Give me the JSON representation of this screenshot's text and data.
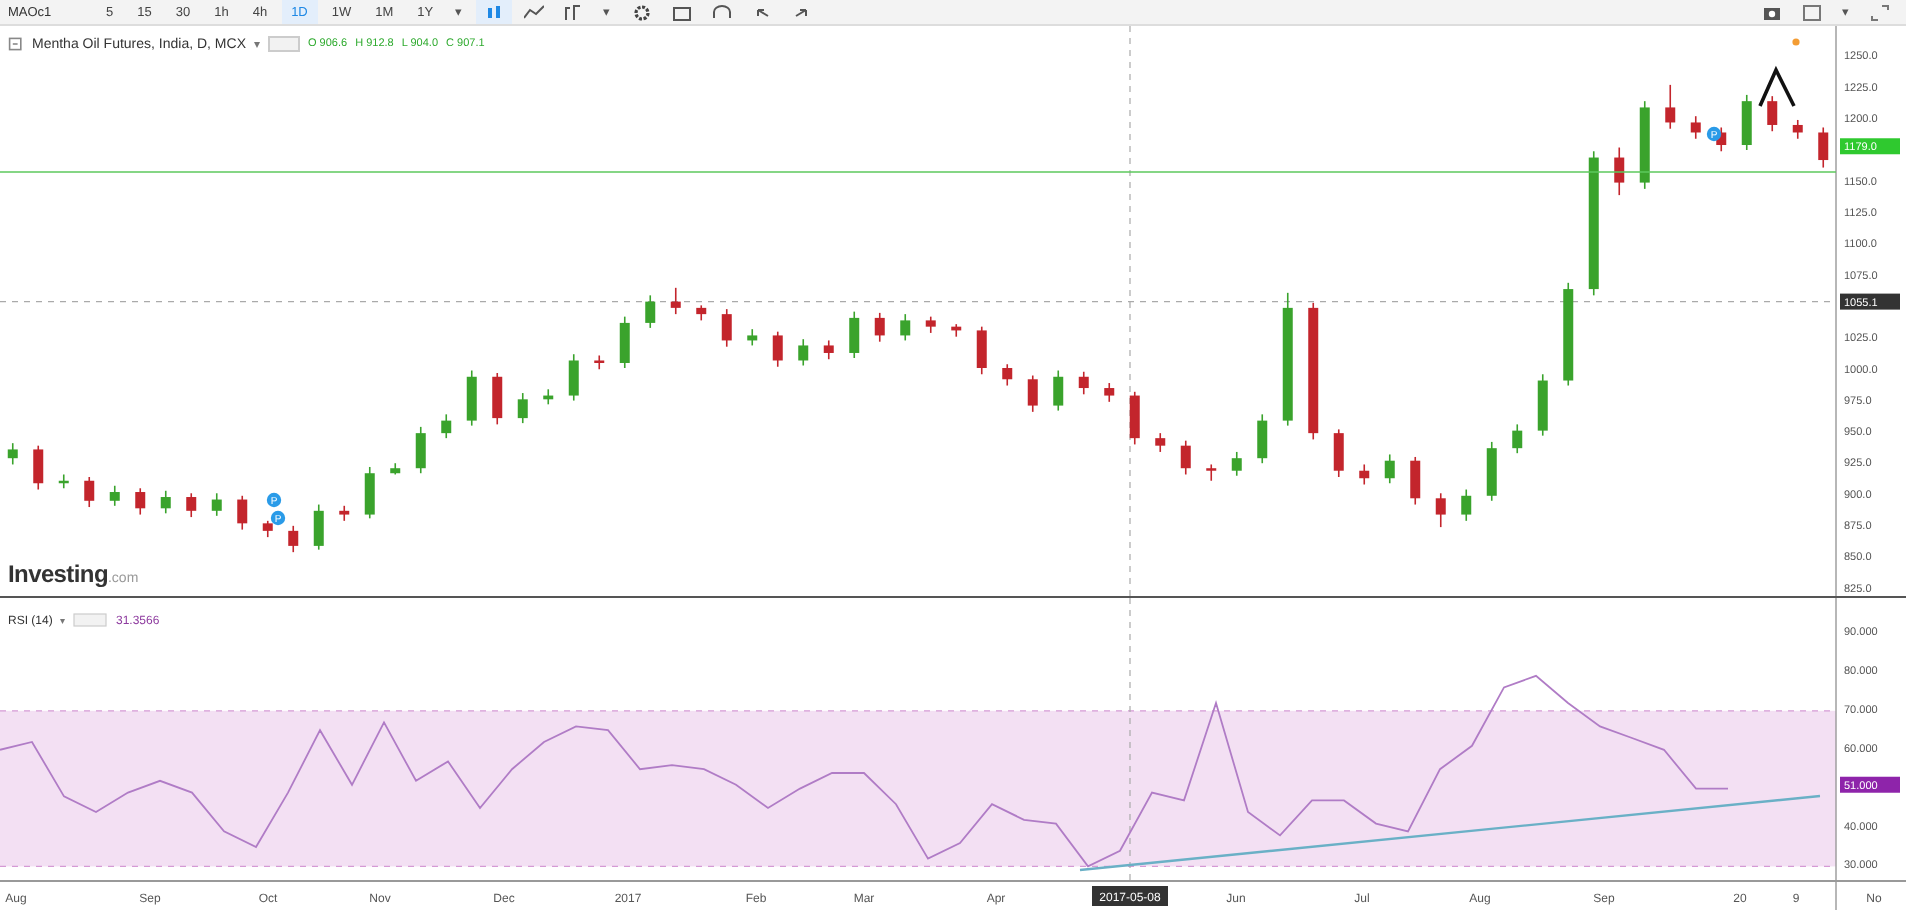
{
  "toolbar": {
    "symbol": "MAOc1",
    "intervals": [
      {
        "label": "5",
        "selected": false
      },
      {
        "label": "15",
        "selected": false
      },
      {
        "label": "30",
        "selected": false
      },
      {
        "label": "1h",
        "selected": false
      },
      {
        "label": "4h",
        "selected": false
      },
      {
        "label": "1D",
        "selected": true
      },
      {
        "label": "1W",
        "selected": false
      },
      {
        "label": "1M",
        "selected": false
      },
      {
        "label": "1Y",
        "selected": false
      }
    ],
    "interval_menu": "▾",
    "indicator_menu": "▾",
    "layout_menu": "▾"
  },
  "price_pane": {
    "legend": {
      "title": "Mentha Oil Futures, India, D, MCX",
      "menu": "▾",
      "ohlc": [
        {
          "label": "O",
          "value": "906.6"
        },
        {
          "label": "H",
          "value": "912.8"
        },
        {
          "label": "L",
          "value": "904.0"
        },
        {
          "label": "C",
          "value": "907.1"
        }
      ]
    },
    "markers": [
      {
        "label": "P"
      },
      {
        "label": "P"
      },
      {
        "label": "P"
      }
    ],
    "chart_data": {
      "type": "candlestick",
      "ylim": [
        820,
        1275
      ],
      "yticks": [
        {
          "value": 1250,
          "label": "1250.0"
        },
        {
          "value": 1225,
          "label": "1225.0"
        },
        {
          "value": 1200,
          "label": "1200.0"
        },
        {
          "value": 1150,
          "label": "1150.0"
        },
        {
          "value": 1125,
          "label": "1125.0"
        },
        {
          "value": 1100,
          "label": "1100.0"
        },
        {
          "value": 1075,
          "label": "1075.0"
        },
        {
          "value": 1025,
          "label": "1025.0"
        },
        {
          "value": 1000,
          "label": "1000.0"
        },
        {
          "value": 975,
          "label": "975.0"
        },
        {
          "value": 950,
          "label": "950.0"
        },
        {
          "value": 925,
          "label": "925.0"
        },
        {
          "value": 900,
          "label": "900.0"
        },
        {
          "value": 875,
          "label": "875.0"
        },
        {
          "value": 850,
          "label": "850.0"
        },
        {
          "value": 825,
          "label": "825.0"
        }
      ],
      "categories": [
        null,
        null,
        null,
        null,
        null,
        null,
        null,
        null,
        null,
        null,
        null,
        null,
        null,
        null,
        null,
        null,
        null,
        null,
        null,
        null,
        null,
        null,
        null,
        null,
        null,
        null,
        null,
        null,
        null,
        null,
        null,
        null,
        null,
        null,
        null,
        null,
        null,
        null,
        null,
        null,
        null,
        null,
        null,
        null,
        null,
        null,
        null,
        null,
        null,
        null,
        null,
        null,
        null,
        null,
        null,
        null,
        null,
        null,
        null,
        null,
        null,
        null,
        null,
        null,
        null,
        null,
        null,
        null,
        null,
        null,
        null,
        null
      ],
      "ohlc": [
        [
          930,
          942,
          925,
          937
        ],
        [
          937,
          940,
          905,
          910
        ],
        [
          910,
          917,
          906,
          912
        ],
        [
          912,
          915,
          891,
          896
        ],
        [
          896,
          908,
          892,
          903
        ],
        [
          903,
          906,
          885,
          890
        ],
        [
          890,
          904,
          886,
          899
        ],
        [
          899,
          902,
          883,
          888
        ],
        [
          888,
          902,
          884,
          897
        ],
        [
          897,
          900,
          873,
          878
        ],
        [
          878,
          880,
          867,
          872
        ],
        [
          872,
          876,
          855,
          860
        ],
        [
          860,
          893,
          857,
          888
        ],
        [
          888,
          892,
          880,
          885
        ],
        [
          885,
          923,
          882,
          918
        ],
        [
          918,
          926,
          917,
          922
        ],
        [
          922,
          955,
          918,
          950
        ],
        [
          950,
          965,
          946,
          960
        ],
        [
          960,
          1000,
          956,
          995
        ],
        [
          995,
          998,
          957,
          962
        ],
        [
          962,
          982,
          958,
          977
        ],
        [
          977,
          985,
          973,
          980
        ],
        [
          980,
          1013,
          976,
          1008
        ],
        [
          1008,
          1012,
          1001,
          1006
        ],
        [
          1006,
          1043,
          1002,
          1038
        ],
        [
          1038,
          1060,
          1034,
          1055
        ],
        [
          1055,
          1066,
          1045,
          1050
        ],
        [
          1050,
          1052,
          1040,
          1045
        ],
        [
          1045,
          1049,
          1019,
          1024
        ],
        [
          1024,
          1033,
          1020,
          1028
        ],
        [
          1028,
          1031,
          1003,
          1008
        ],
        [
          1008,
          1025,
          1004,
          1020
        ],
        [
          1020,
          1024,
          1009,
          1014
        ],
        [
          1014,
          1047,
          1010,
          1042
        ],
        [
          1042,
          1046,
          1023,
          1028
        ],
        [
          1028,
          1045,
          1024,
          1040
        ],
        [
          1040,
          1043,
          1030,
          1035
        ],
        [
          1035,
          1037,
          1027,
          1032
        ],
        [
          1032,
          1035,
          997,
          1002
        ],
        [
          1002,
          1005,
          988,
          993
        ],
        [
          993,
          996,
          967,
          972
        ],
        [
          972,
          1000,
          968,
          995
        ],
        [
          995,
          999,
          981,
          986
        ],
        [
          986,
          990,
          975,
          980
        ],
        [
          980,
          983,
          941,
          946
        ],
        [
          946,
          950,
          935,
          940
        ],
        [
          940,
          944,
          917,
          922
        ],
        [
          922,
          925,
          912,
          920
        ],
        [
          920,
          935,
          916,
          930
        ],
        [
          930,
          965,
          926,
          960
        ],
        [
          960,
          1062,
          956,
          1050
        ],
        [
          1050,
          1054,
          945,
          950
        ],
        [
          950,
          953,
          915,
          920
        ],
        [
          920,
          925,
          909,
          914
        ],
        [
          914,
          933,
          910,
          928
        ],
        [
          928,
          931,
          893,
          898
        ],
        [
          898,
          902,
          875,
          885
        ],
        [
          885,
          905,
          880,
          900
        ],
        [
          900,
          943,
          896,
          938
        ],
        [
          938,
          957,
          934,
          952
        ],
        [
          952,
          997,
          948,
          992
        ],
        [
          992,
          1070,
          988,
          1065
        ],
        [
          1065,
          1175,
          1060,
          1170
        ],
        [
          1170,
          1178,
          1140,
          1150
        ],
        [
          1150,
          1215,
          1145,
          1210
        ],
        [
          1210,
          1228,
          1193,
          1198
        ],
        [
          1198,
          1203,
          1185,
          1190
        ],
        [
          1190,
          1194,
          1175,
          1180
        ],
        [
          1180,
          1220,
          1176,
          1215
        ],
        [
          1215,
          1219,
          1191,
          1196
        ],
        [
          1196,
          1200,
          1185,
          1190
        ],
        [
          1190,
          1194,
          1162,
          1168
        ]
      ]
    },
    "last_price": "1179.0",
    "crosshair_price": "1055.1",
    "logo": {
      "name": "Investing",
      "suffix": ".com"
    }
  },
  "rsi_pane": {
    "legend": {
      "menu": "▾",
      "value": "31.3566"
    },
    "chart_data": {
      "type": "line",
      "ylim": [
        26,
        99
      ],
      "categories": [
        null,
        null,
        null,
        null,
        null,
        null,
        null,
        null,
        null,
        null,
        null,
        null,
        null,
        null,
        null,
        null,
        null,
        null,
        null,
        null,
        null,
        null,
        null,
        null,
        null,
        null,
        null,
        null,
        null,
        null,
        null,
        null,
        null,
        null,
        null,
        null,
        null,
        null,
        null,
        null,
        null,
        null,
        null,
        null,
        null,
        null,
        null,
        null,
        null,
        null,
        null,
        null,
        null,
        null,
        null
      ],
      "yticks": [
        {
          "value": 90,
          "label": "90.000"
        },
        {
          "value": 80,
          "label": "80.000"
        },
        {
          "value": 70,
          "label": "70.000"
        },
        {
          "value": 60,
          "label": "60.000"
        },
        {
          "value": 40,
          "label": "40.000"
        },
        {
          "value": 30,
          "label": "30.000"
        }
      ],
      "series": [
        {
          "name": "RSI (14)",
          "color": "#b07cc6",
          "values": [
            60,
            62,
            48,
            44,
            49,
            52,
            49,
            39,
            35,
            49,
            65,
            51,
            67,
            52,
            57,
            45,
            55,
            62,
            66,
            65,
            55,
            56,
            55,
            51,
            45,
            50,
            54,
            54,
            46,
            32,
            36,
            46,
            42,
            41,
            30,
            34,
            49,
            47,
            72,
            44,
            38,
            47,
            47,
            41,
            39,
            55,
            61,
            76,
            79,
            72,
            66,
            63,
            60,
            50,
            50
          ]
        }
      ]
    },
    "last_value": "51.000"
  },
  "time_axis": {
    "labels": [
      "Aug",
      "Sep",
      "Oct",
      "Nov",
      "Dec",
      "2017",
      "Feb",
      "Mar",
      "Apr",
      "Jun",
      "Jul",
      "Aug",
      "Sep",
      "20",
      "9",
      "No"
    ],
    "crosshair_date": "2017-05-08"
  }
}
